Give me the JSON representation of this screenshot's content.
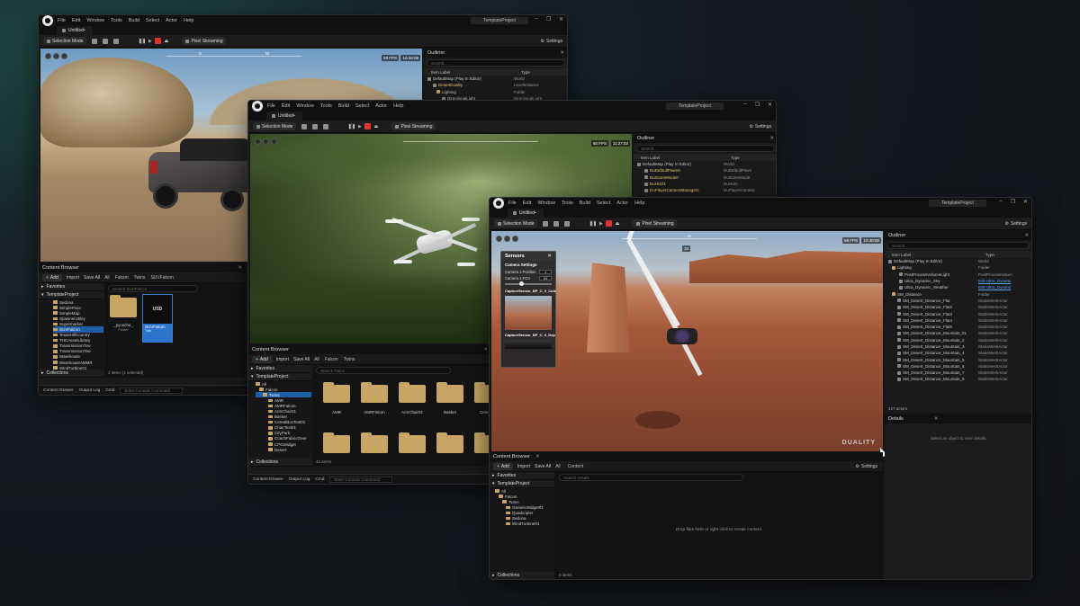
{
  "menu": [
    "File",
    "Edit",
    "Window",
    "Tools",
    "Build",
    "Select",
    "Actor",
    "Help"
  ],
  "project": "TemplateProject",
  "doc_tab": "Untitled•",
  "toolbar": {
    "mode": "Selection Mode",
    "pixel_streaming": "Pixel Streaming",
    "settings": "Settings"
  },
  "w1": {
    "fps": "58 FPS",
    "time": "10:28:08",
    "compass": [
      "N",
      "W"
    ],
    "outliner": {
      "title": "Outliner",
      "search": "Search...",
      "col_label": "Item Label",
      "col_type": "Type",
      "rows": [
        [
          "DefaultMap (Play In Editor)",
          "World"
        ],
        [
          "DesertDuality",
          "LevelInstance"
        ],
        [
          "Lighting",
          "Folder"
        ],
        [
          "DirectionalLight",
          "DirectionalLight"
        ]
      ]
    },
    "cb": {
      "title": "Content Browser",
      "add": "Add",
      "import": "Import",
      "saveall": "Save All",
      "crumbs": [
        "All",
        "Falcon",
        "Twins",
        "SUVFalcon"
      ],
      "search": "Search SUVFalcon",
      "favorites": "Favorites",
      "project": "TemplateProject",
      "tree": [
        "Sedona",
        "SimpleFloor",
        "SimpleMap",
        "SpawnerUtility",
        "Supermarket",
        "SUVFalcon",
        "TexasHillCountry",
        "THCAssetLibrary",
        "TransmissionTow",
        "TransmissionTow",
        "Warehouse",
        "WarehouseAMMR",
        "WindTurbine01"
      ],
      "tiles": [
        {
          "name": "_pycache_",
          "type": "Folder"
        },
        {
          "name": "SUVFalcon",
          "type": "Twin",
          "badge": "USD"
        }
      ],
      "count": "2 items (1 selected)",
      "collections": "Collections"
    },
    "bottom": {
      "drawer": "Content Drawer",
      "log": "Output Log",
      "cmd": "Cmd",
      "placeholder": "Enter Console Command"
    }
  },
  "w2": {
    "fps": "60 FPS",
    "time": "11:27:03",
    "outliner": {
      "title": "Outliner",
      "search": "Search...",
      "col_label": "Item Label",
      "col_type": "Type",
      "rows": [
        [
          "DefaultMap (Play In Editor)",
          "World"
        ],
        [
          "DuDefaultPawn0",
          "DuDefaultPawn"
        ],
        [
          "DuGameMode0",
          "DuGameMode"
        ],
        [
          "DuHUD1",
          "DuHUD"
        ],
        [
          "DuPlayerCameraManager1",
          "DuPlayerCamera"
        ]
      ]
    },
    "cb": {
      "title": "Content Browser",
      "add": "Add",
      "import": "Import",
      "saveall": "Save All",
      "crumbs": [
        "All",
        "Falcon",
        "Twins"
      ],
      "search": "Search Twins",
      "favorites": "Favorites",
      "project": "TemplateProject",
      "tree": [
        "All",
        "Falcon",
        "Twins",
        "AMR",
        "AMRFalcon",
        "ArmChair01",
        "Basket",
        "CerealBoxTest01",
        "ChairTest01",
        "CityPark",
        "CoachFabricGree",
        "CPGWidget",
        "Desert"
      ],
      "tiles": [
        {
          "name": "AMR"
        },
        {
          "name": "AMRFalcon"
        },
        {
          "name": "ArmChair01"
        },
        {
          "name": "Basket"
        },
        {
          "name": "Cere Tes"
        }
      ],
      "count": "42 items",
      "collections": "Collections"
    },
    "bottom": {
      "drawer": "Content Drawer",
      "log": "Output Log",
      "cmd": "Cmd",
      "placeholder": "Enter Console Command"
    }
  },
  "w3": {
    "fps": "58 FPS",
    "time": "10:48:00",
    "compass": [
      "N"
    ],
    "heading": "10",
    "sensors": {
      "title": "Sensors",
      "section": "Camera Settings",
      "pos_label": "Camera 1 Position",
      "pos_val": "1",
      "fov_label": "Camera 1 FOV",
      "fov_val": "63",
      "cap1": "CaptureSensor_BP_C_0_Colo",
      "cap2": "CaptureSensor_BP_C_0_Dep"
    },
    "brand": "DUALITY",
    "outliner": {
      "title": "Outliner",
      "search": "Search...",
      "col_label": "Item Label",
      "col_type": "Type",
      "rows": [
        [
          "DefaultMap (Play In Editor)",
          "World"
        ],
        [
          "Lighting",
          "Folder"
        ],
        [
          "PostProcessVolumeLight",
          "PostProcessVolum"
        ],
        [
          "Ultra_Dynamic_Sky",
          "Edit Ultra_Dynami"
        ],
        [
          "Ultra_Dynamic_Weather",
          "Edit Ultra_Dynami"
        ],
        [
          "SM_Distance",
          "Folder"
        ],
        [
          "SM_Desert_Distance_Flat",
          "StaticMeshActor"
        ],
        [
          "SM_Desert_Distance_Flat2",
          "StaticMeshActor"
        ],
        [
          "SM_Desert_Distance_Flat3",
          "StaticMeshActor"
        ],
        [
          "SM_Desert_Distance_Flat4",
          "StaticMeshActor"
        ],
        [
          "SM_Desert_Distance_Flat5",
          "StaticMeshActor"
        ],
        [
          "SM_Desert_Distance_Mountain_01",
          "StaticMeshActor"
        ],
        [
          "SM_Desert_Distance_Mountain_2",
          "StaticMeshActor"
        ],
        [
          "SM_Desert_Distance_Mountain_3",
          "StaticMeshActor"
        ],
        [
          "SM_Desert_Distance_Mountain_4",
          "StaticMeshActor"
        ],
        [
          "SM_Desert_Distance_Mountain_5",
          "StaticMeshActor"
        ],
        [
          "SM_Desert_Distance_Mountain_6",
          "StaticMeshActor"
        ],
        [
          "SM_Desert_Distance_Mountain_7",
          "StaticMeshActor"
        ],
        [
          "SM_Desert_Distance_Mountain_8",
          "StaticMeshActor"
        ]
      ],
      "actors": "427 actors"
    },
    "details": {
      "title": "Details",
      "hint": "Select an object to view details."
    },
    "cb": {
      "title": "Content Browser",
      "add": "Add",
      "import": "Import",
      "saveall": "Save All",
      "crumbs": [
        "All",
        "Content"
      ],
      "settings": "Settings",
      "search": "Search Assets",
      "favorites": "Favorites",
      "project": "TemplateProject",
      "tree": [
        "All",
        "Falcon",
        "Twins",
        "GenericWidget01",
        "Quadcopter",
        "Sedona",
        "WindTurbine01"
      ],
      "empty": "Drop files here or right click to create content.",
      "count": "0 items",
      "collections": "Collections"
    }
  }
}
